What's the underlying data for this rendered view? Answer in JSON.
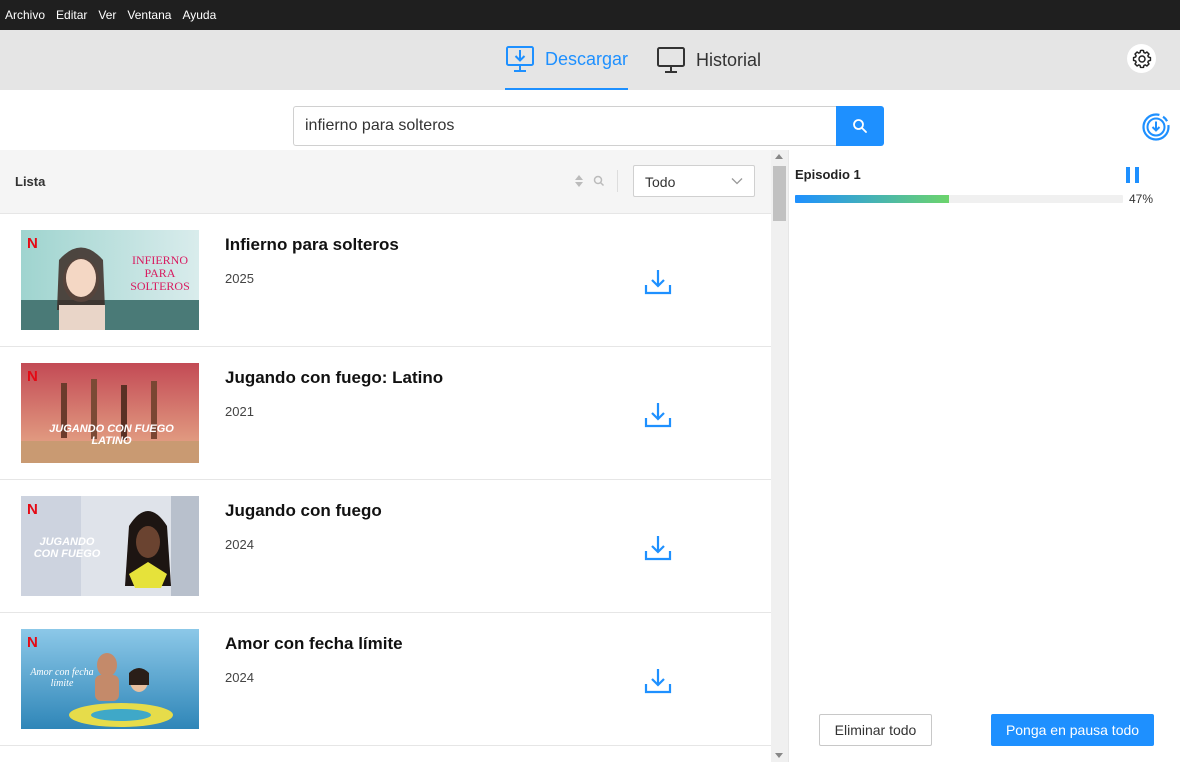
{
  "menu": [
    "Archivo",
    "Editar",
    "Ver",
    "Ventana",
    "Ayuda"
  ],
  "tabs": {
    "download": "Descargar",
    "history": "Historial"
  },
  "search": {
    "value": "infierno para solteros",
    "placeholder": ""
  },
  "list": {
    "title": "Lista",
    "filter": "Todo",
    "items": [
      {
        "title": "Infierno para solteros",
        "year": "2025",
        "thumb_caption": "INFIERNO PARA SOLTEROS",
        "badge": "N"
      },
      {
        "title": "Jugando con fuego: Latino",
        "year": "2021",
        "thumb_caption": "JUGANDO CON FUEGO LATINO",
        "badge": "N"
      },
      {
        "title": "Jugando con fuego",
        "year": "2024",
        "thumb_caption": "JUGANDO CON FUEGO",
        "badge": "N"
      },
      {
        "title": "Amor con fecha límite",
        "year": "2024",
        "thumb_caption": "Amor con fecha límite",
        "badge": "N"
      }
    ]
  },
  "queue": {
    "episode": "Episodio 1",
    "progress": 0.47,
    "progress_label": "47%",
    "remove_all": "Eliminar todo",
    "pause_all": "Ponga en pausa todo"
  },
  "colors": {
    "accent": "#1e90ff",
    "menubar": "#1f1f1f",
    "netflix": "#e50914"
  },
  "icons": {
    "download_tab": "monitor-download-icon",
    "history_tab": "monitor-icon",
    "settings": "gear-icon",
    "search": "search-icon",
    "queue": "circle-download-icon",
    "row_download": "download-icon",
    "pause": "pause-icon"
  }
}
